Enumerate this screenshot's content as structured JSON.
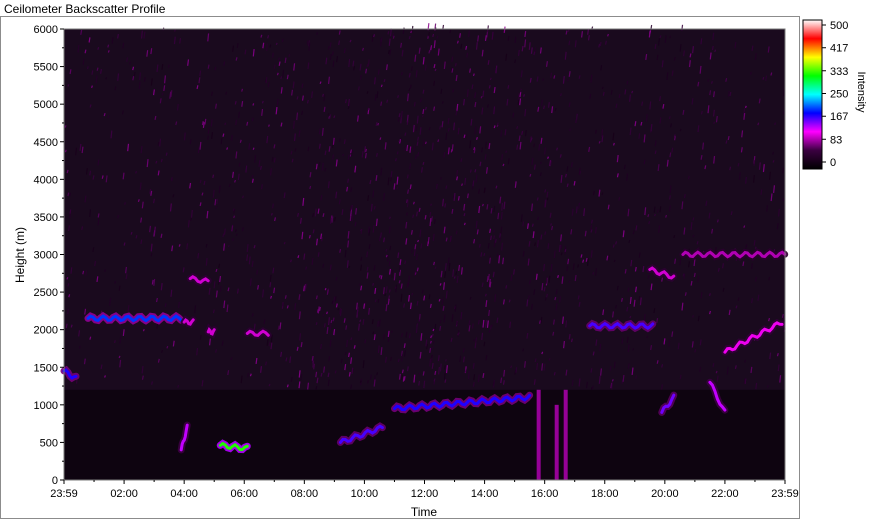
{
  "window": {
    "title": "Ceilometer Backscatter Profile"
  },
  "chart_data": {
    "type": "heatmap",
    "title": "",
    "xlabel": "Time",
    "ylabel": "Height (m)",
    "x_ticks": [
      "23:59",
      "02:00",
      "04:00",
      "06:00",
      "08:00",
      "10:00",
      "12:00",
      "14:00",
      "16:00",
      "18:00",
      "20:00",
      "22:00",
      "23:59"
    ],
    "y_ticks": [
      0,
      500,
      1000,
      1500,
      2000,
      2500,
      3000,
      3500,
      4000,
      4500,
      5000,
      5500,
      6000
    ],
    "ylim": [
      0,
      6000
    ],
    "xlim_hours": [
      0,
      24
    ],
    "grid": false,
    "colorbar": {
      "label": "Intensity",
      "ticks": [
        500,
        417,
        333,
        250,
        167,
        83,
        0
      ],
      "range": [
        0,
        500
      ],
      "colors": [
        "#000000",
        "#3a0040",
        "#ff00ff",
        "#0000ff",
        "#00ffff",
        "#00ff00",
        "#ffff00",
        "#ff0000",
        "#ffffff"
      ]
    },
    "background_noise": {
      "description_intensity": "diffuse magenta speckle above 1200 m, densest between 08:00 and 16:00",
      "typical_intensity": 60
    },
    "layers": [
      {
        "name": "",
        "time_start": 0.0,
        "time_end": 0.4,
        "height_start": 1450,
        "height_end": 1350,
        "intensity": 180
      },
      {
        "name": "",
        "time_start": 0.8,
        "time_end": 3.9,
        "height_start": 2150,
        "height_end": 2150,
        "intensity": 200
      },
      {
        "name": "",
        "time_start": 4.2,
        "time_end": 4.8,
        "height_start": 2680,
        "height_end": 2640,
        "intensity": 110
      },
      {
        "name": "",
        "time_start": 4.0,
        "time_end": 4.3,
        "height_start": 2100,
        "height_end": 2100,
        "intensity": 110
      },
      {
        "name": "",
        "time_start": 4.8,
        "time_end": 5.0,
        "height_start": 1970,
        "height_end": 1970,
        "intensity": 110
      },
      {
        "name": "",
        "time_start": 6.1,
        "time_end": 6.8,
        "height_start": 1950,
        "height_end": 1950,
        "intensity": 110
      },
      {
        "name": "",
        "time_start": 5.2,
        "time_end": 6.1,
        "height_start": 460,
        "height_end": 420,
        "intensity": 320
      },
      {
        "name": "",
        "time_start": 3.9,
        "time_end": 4.1,
        "height_start": 400,
        "height_end": 700,
        "intensity": 140
      },
      {
        "name": "",
        "time_start": 9.2,
        "time_end": 10.6,
        "height_start": 500,
        "height_end": 700,
        "intensity": 170
      },
      {
        "name": "",
        "time_start": 11.0,
        "time_end": 15.5,
        "height_start": 950,
        "height_end": 1100,
        "intensity": 180
      },
      {
        "name": "",
        "time_start": 17.5,
        "time_end": 19.6,
        "height_start": 2050,
        "height_end": 2050,
        "intensity": 170
      },
      {
        "name": "",
        "time_start": 19.5,
        "time_end": 20.3,
        "height_start": 2800,
        "height_end": 2700,
        "intensity": 110
      },
      {
        "name": "",
        "time_start": 20.6,
        "time_end": 23.99,
        "height_start": 3000,
        "height_end": 3000,
        "intensity": 100
      },
      {
        "name": "",
        "time_start": 19.9,
        "time_end": 20.3,
        "height_start": 900,
        "height_end": 1100,
        "intensity": 160
      },
      {
        "name": "",
        "time_start": 21.5,
        "time_end": 22.0,
        "height_start": 1300,
        "height_end": 900,
        "intensity": 140
      },
      {
        "name": "",
        "time_start": 22.0,
        "time_end": 23.9,
        "height_start": 1700,
        "height_end": 2100,
        "intensity": 120
      }
    ],
    "rain_streaks": [
      {
        "time": 15.8,
        "height_top": 1200,
        "intensity": 110
      },
      {
        "time": 16.4,
        "height_top": 1000,
        "intensity": 110
      },
      {
        "time": 16.7,
        "height_top": 1200,
        "intensity": 110
      }
    ]
  }
}
